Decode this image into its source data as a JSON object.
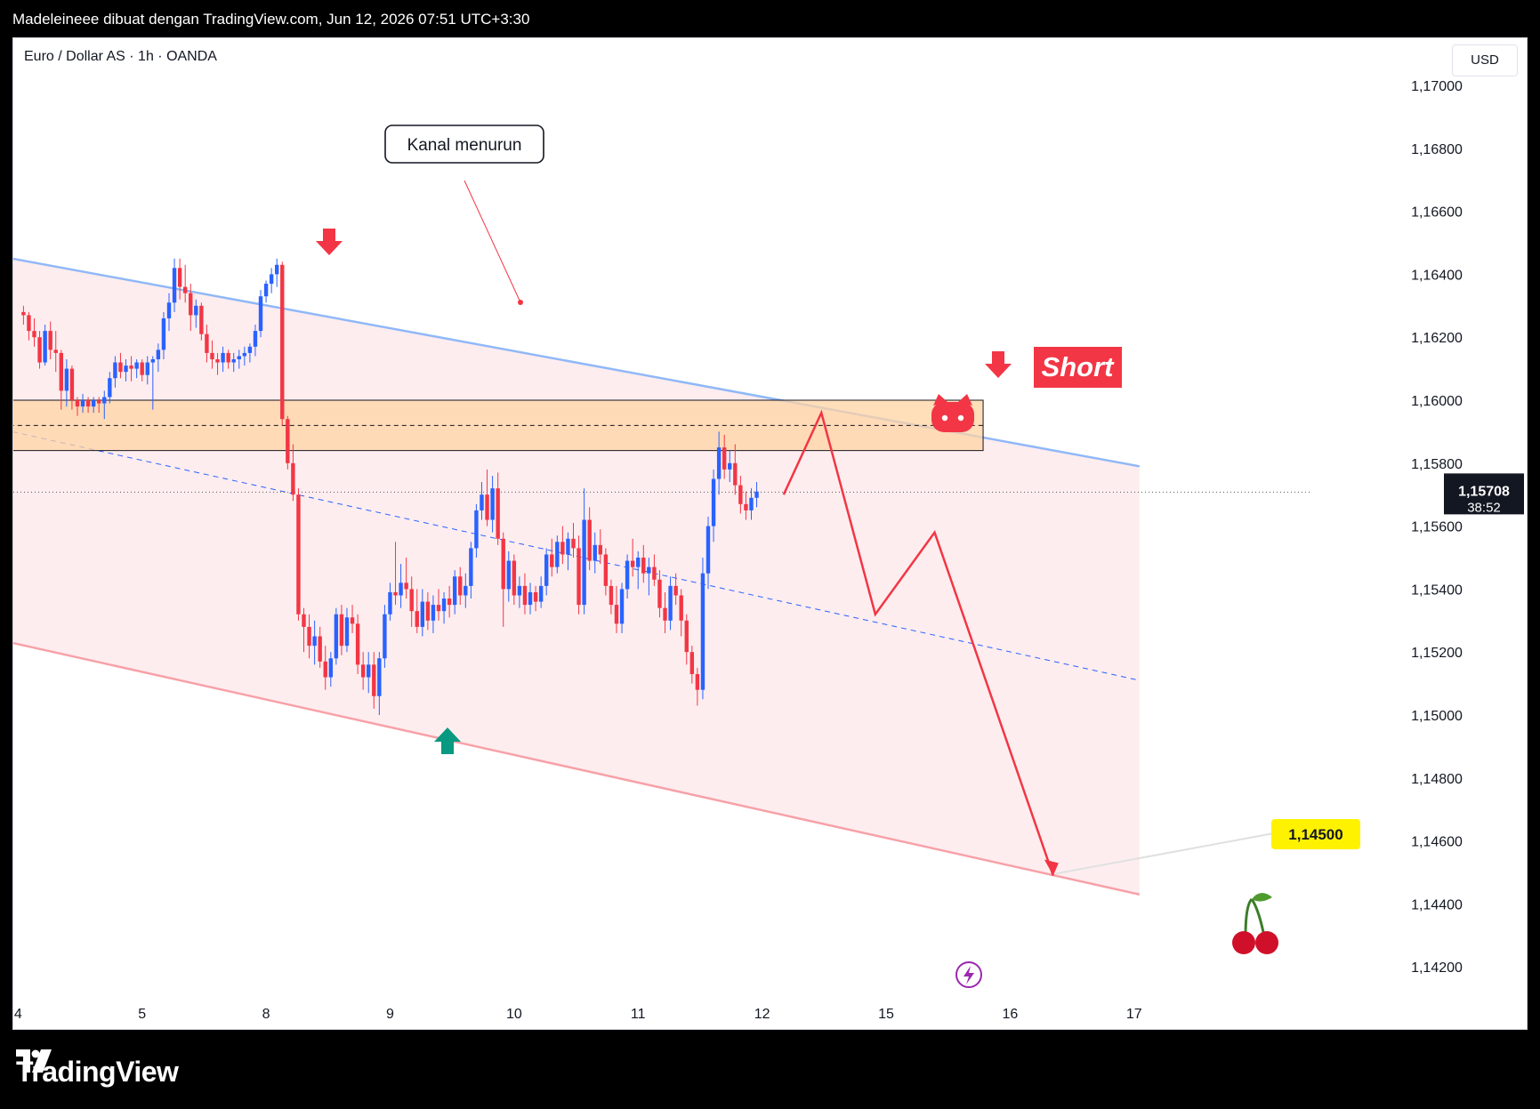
{
  "header": {
    "attribution": "Madeleineee dibuat dengan TradingView.com, Jun 12, 2026 07:51 UTC+3:30"
  },
  "chart": {
    "symbol_line": "Euro / Dollar AS · 1h · OANDA",
    "currency": "USD",
    "annotation_label": "Kanal menurun",
    "short_label": "Short",
    "target_label": "1,14500",
    "current_price": "1,15708",
    "countdown": "38:52"
  },
  "footer": {
    "brand": "TradingView"
  },
  "colors": {
    "up": "#2962ff",
    "down": "#f23645",
    "channel_top": "#90b8f8",
    "channel_bottom": "#f7a1a8",
    "channel_fill": "#fde7e9",
    "zone_fill": "#ffd3a3",
    "projection": "#f23645",
    "short_bg": "#f23645",
    "target_bg": "#fff200",
    "buy_arrow": "#089981"
  },
  "chart_data": {
    "type": "candlestick",
    "ylim": [
      1.141,
      1.171
    ],
    "y_ticks": [
      "1,17000",
      "1,16800",
      "1,16600",
      "1,16400",
      "1,16200",
      "1,16000",
      "1,15800",
      "1,15600",
      "1,15400",
      "1,15200",
      "1,15000",
      "1,14800",
      "1,14600",
      "1,14400",
      "1,14200"
    ],
    "y_tick_values": [
      1.17,
      1.168,
      1.166,
      1.164,
      1.162,
      1.16,
      1.158,
      1.156,
      1.154,
      1.152,
      1.15,
      1.148,
      1.146,
      1.144,
      1.142
    ],
    "x_ticks": [
      "4",
      "5",
      "8",
      "9",
      "10",
      "11",
      "12",
      "15",
      "16",
      "17"
    ],
    "x_tick_index": [
      22,
      45,
      68,
      91,
      114,
      137,
      160,
      183,
      206,
      229
    ],
    "x_range_index": [
      5,
      235
    ],
    "resistance_zone": [
      1.1584,
      1.16
    ],
    "current_price": 1.15708,
    "target": 1.145,
    "channel": {
      "upper": [
        [
          5,
          1.165
        ],
        [
          230,
          1.1579
        ]
      ],
      "lower": [
        [
          5,
          1.1529
        ],
        [
          230,
          1.1443
        ]
      ],
      "mid": [
        [
          5,
          1.1596
        ],
        [
          230,
          1.1511
        ]
      ]
    },
    "projection_path": [
      [
        164,
        1.157
      ],
      [
        171,
        1.1596
      ],
      [
        181,
        1.1532
      ],
      [
        192,
        1.1558
      ],
      [
        214,
        1.1449
      ]
    ],
    "candles_ohlc": [
      [
        1.1628,
        1.163,
        1.1624,
        1.1627
      ],
      [
        1.1627,
        1.1628,
        1.1619,
        1.1622
      ],
      [
        1.1622,
        1.1626,
        1.1617,
        1.162
      ],
      [
        1.162,
        1.1622,
        1.161,
        1.1612
      ],
      [
        1.1612,
        1.1624,
        1.1611,
        1.1622
      ],
      [
        1.1622,
        1.1625,
        1.1613,
        1.1616
      ],
      [
        1.1616,
        1.1622,
        1.1609,
        1.1615
      ],
      [
        1.1615,
        1.1616,
        1.1597,
        1.1603
      ],
      [
        1.1603,
        1.1613,
        1.1598,
        1.161
      ],
      [
        1.161,
        1.1611,
        1.1597,
        1.16
      ],
      [
        1.16,
        1.1601,
        1.1595,
        1.1598
      ],
      [
        1.1598,
        1.1602,
        1.1596,
        1.16
      ],
      [
        1.16,
        1.1601,
        1.1596,
        1.1598
      ],
      [
        1.1598,
        1.1601,
        1.1596,
        1.16
      ],
      [
        1.16,
        1.1601,
        1.1596,
        1.1599
      ],
      [
        1.1599,
        1.1603,
        1.1594,
        1.1601
      ],
      [
        1.1601,
        1.1609,
        1.1599,
        1.1607
      ],
      [
        1.1607,
        1.1614,
        1.1604,
        1.1612
      ],
      [
        1.1612,
        1.1615,
        1.1607,
        1.1609
      ],
      [
        1.1609,
        1.1613,
        1.1606,
        1.1611
      ],
      [
        1.1611,
        1.1614,
        1.1606,
        1.161
      ],
      [
        1.161,
        1.1613,
        1.1607,
        1.1612
      ],
      [
        1.1612,
        1.1613,
        1.1606,
        1.1608
      ],
      [
        1.1608,
        1.1614,
        1.1605,
        1.1612
      ],
      [
        1.1612,
        1.1614,
        1.1597,
        1.1613
      ],
      [
        1.1613,
        1.1618,
        1.1609,
        1.1616
      ],
      [
        1.1616,
        1.1628,
        1.1613,
        1.1626
      ],
      [
        1.1626,
        1.1634,
        1.1622,
        1.1631
      ],
      [
        1.1631,
        1.1645,
        1.1628,
        1.1642
      ],
      [
        1.1642,
        1.1645,
        1.1632,
        1.1636
      ],
      [
        1.1636,
        1.1643,
        1.1631,
        1.1634
      ],
      [
        1.1634,
        1.1637,
        1.1622,
        1.1627
      ],
      [
        1.1627,
        1.1632,
        1.1623,
        1.163
      ],
      [
        1.163,
        1.1631,
        1.1619,
        1.1621
      ],
      [
        1.1621,
        1.1624,
        1.1612,
        1.1615
      ],
      [
        1.1615,
        1.1619,
        1.161,
        1.1613
      ],
      [
        1.1613,
        1.1615,
        1.1608,
        1.1612
      ],
      [
        1.1612,
        1.1617,
        1.1609,
        1.1615
      ],
      [
        1.1615,
        1.1616,
        1.161,
        1.1612
      ],
      [
        1.1612,
        1.1615,
        1.1609,
        1.1613
      ],
      [
        1.1613,
        1.1616,
        1.161,
        1.1614
      ],
      [
        1.1614,
        1.1617,
        1.1611,
        1.1615
      ],
      [
        1.1615,
        1.1618,
        1.1612,
        1.1617
      ],
      [
        1.1617,
        1.1624,
        1.1614,
        1.1622
      ],
      [
        1.1622,
        1.1635,
        1.162,
        1.1633
      ],
      [
        1.1633,
        1.1638,
        1.1631,
        1.1637
      ],
      [
        1.1637,
        1.1642,
        1.1634,
        1.164
      ],
      [
        1.164,
        1.1645,
        1.1636,
        1.1643
      ],
      [
        1.1643,
        1.1644,
        1.1592,
        1.1594
      ],
      [
        1.1594,
        1.1595,
        1.1578,
        1.158
      ],
      [
        1.158,
        1.1586,
        1.1568,
        1.157
      ],
      [
        1.157,
        1.1572,
        1.153,
        1.1532
      ],
      [
        1.1532,
        1.1534,
        1.152,
        1.1528
      ],
      [
        1.1528,
        1.1532,
        1.1518,
        1.1522
      ],
      [
        1.1522,
        1.153,
        1.1516,
        1.1525
      ],
      [
        1.1525,
        1.1528,
        1.1515,
        1.1517
      ],
      [
        1.1517,
        1.1522,
        1.1508,
        1.1512
      ],
      [
        1.1512,
        1.152,
        1.1509,
        1.1518
      ],
      [
        1.1518,
        1.1534,
        1.1516,
        1.1532
      ],
      [
        1.1532,
        1.1535,
        1.1519,
        1.1522
      ],
      [
        1.1522,
        1.1534,
        1.152,
        1.1531
      ],
      [
        1.1531,
        1.1535,
        1.1526,
        1.1529
      ],
      [
        1.1529,
        1.1532,
        1.1513,
        1.1516
      ],
      [
        1.1516,
        1.152,
        1.1508,
        1.1512
      ],
      [
        1.1512,
        1.152,
        1.1507,
        1.1516
      ],
      [
        1.1516,
        1.152,
        1.1502,
        1.1506
      ],
      [
        1.1506,
        1.152,
        1.15,
        1.1518
      ],
      [
        1.1518,
        1.1535,
        1.1515,
        1.1532
      ],
      [
        1.1532,
        1.1542,
        1.153,
        1.1539
      ],
      [
        1.1539,
        1.1555,
        1.1535,
        1.1538
      ],
      [
        1.1538,
        1.1548,
        1.1534,
        1.1542
      ],
      [
        1.1542,
        1.155,
        1.1537,
        1.154
      ],
      [
        1.154,
        1.1544,
        1.1528,
        1.1533
      ],
      [
        1.1533,
        1.154,
        1.1526,
        1.1528
      ],
      [
        1.1528,
        1.154,
        1.1525,
        1.1536
      ],
      [
        1.1536,
        1.1539,
        1.1527,
        1.153
      ],
      [
        1.153,
        1.1538,
        1.1526,
        1.1535
      ],
      [
        1.1535,
        1.154,
        1.153,
        1.1533
      ],
      [
        1.1533,
        1.1539,
        1.1529,
        1.1537
      ],
      [
        1.1537,
        1.1541,
        1.1531,
        1.1535
      ],
      [
        1.1535,
        1.1546,
        1.1532,
        1.1544
      ],
      [
        1.1544,
        1.1547,
        1.1535,
        1.1538
      ],
      [
        1.1538,
        1.1545,
        1.1534,
        1.1541
      ],
      [
        1.1541,
        1.1555,
        1.1537,
        1.1553
      ],
      [
        1.1553,
        1.1567,
        1.155,
        1.1565
      ],
      [
        1.1565,
        1.1574,
        1.1562,
        1.157
      ],
      [
        1.157,
        1.1578,
        1.156,
        1.1562
      ],
      [
        1.1562,
        1.1576,
        1.1558,
        1.1572
      ],
      [
        1.1572,
        1.1577,
        1.1554,
        1.1556
      ],
      [
        1.1556,
        1.1558,
        1.1528,
        1.154
      ],
      [
        1.154,
        1.1552,
        1.1536,
        1.1549
      ],
      [
        1.1549,
        1.1551,
        1.1535,
        1.1538
      ],
      [
        1.1538,
        1.1544,
        1.1534,
        1.1541
      ],
      [
        1.1541,
        1.1545,
        1.1532,
        1.1535
      ],
      [
        1.1535,
        1.1542,
        1.1532,
        1.1539
      ],
      [
        1.1539,
        1.1541,
        1.1533,
        1.1536
      ],
      [
        1.1536,
        1.1544,
        1.1534,
        1.1541
      ],
      [
        1.1541,
        1.1553,
        1.1538,
        1.1551
      ],
      [
        1.1551,
        1.1556,
        1.1544,
        1.1547
      ],
      [
        1.1547,
        1.1557,
        1.1545,
        1.1555
      ],
      [
        1.1555,
        1.156,
        1.1548,
        1.1551
      ],
      [
        1.1551,
        1.1558,
        1.1546,
        1.1556
      ],
      [
        1.1556,
        1.1561,
        1.155,
        1.1553
      ],
      [
        1.1553,
        1.1557,
        1.1532,
        1.1535
      ],
      [
        1.1535,
        1.1572,
        1.1532,
        1.1562
      ],
      [
        1.1562,
        1.1566,
        1.1546,
        1.1549
      ],
      [
        1.1549,
        1.1558,
        1.1545,
        1.1554
      ],
      [
        1.1554,
        1.1559,
        1.1548,
        1.1551
      ],
      [
        1.1551,
        1.1553,
        1.1538,
        1.1541
      ],
      [
        1.1541,
        1.1543,
        1.1532,
        1.1535
      ],
      [
        1.1535,
        1.1541,
        1.1526,
        1.1529
      ],
      [
        1.1529,
        1.1542,
        1.1526,
        1.154
      ],
      [
        1.154,
        1.1551,
        1.1537,
        1.1549
      ],
      [
        1.1549,
        1.1556,
        1.1544,
        1.1547
      ],
      [
        1.1547,
        1.1552,
        1.154,
        1.155
      ],
      [
        1.155,
        1.1554,
        1.1542,
        1.1545
      ],
      [
        1.1545,
        1.155,
        1.1538,
        1.1547
      ],
      [
        1.1547,
        1.1551,
        1.1541,
        1.1543
      ],
      [
        1.1543,
        1.1546,
        1.1531,
        1.1534
      ],
      [
        1.1534,
        1.1539,
        1.1526,
        1.153
      ],
      [
        1.153,
        1.1544,
        1.1527,
        1.1541
      ],
      [
        1.1541,
        1.1545,
        1.1535,
        1.1538
      ],
      [
        1.1538,
        1.154,
        1.1525,
        1.153
      ],
      [
        1.153,
        1.1532,
        1.1516,
        1.152
      ],
      [
        1.152,
        1.1522,
        1.151,
        1.1513
      ],
      [
        1.1513,
        1.1515,
        1.1503,
        1.1508
      ],
      [
        1.1508,
        1.155,
        1.1505,
        1.1545
      ],
      [
        1.1545,
        1.1563,
        1.154,
        1.156
      ],
      [
        1.156,
        1.1578,
        1.1555,
        1.1575
      ],
      [
        1.1575,
        1.159,
        1.157,
        1.1585
      ],
      [
        1.1585,
        1.1589,
        1.1575,
        1.1578
      ],
      [
        1.1578,
        1.1584,
        1.1574,
        1.158
      ],
      [
        1.158,
        1.1586,
        1.157,
        1.1573
      ],
      [
        1.1573,
        1.1576,
        1.1564,
        1.1567
      ],
      [
        1.1567,
        1.1571,
        1.1562,
        1.1565
      ],
      [
        1.1565,
        1.1572,
        1.1562,
        1.1569
      ],
      [
        1.1569,
        1.1574,
        1.1566,
        1.1571
      ]
    ]
  }
}
